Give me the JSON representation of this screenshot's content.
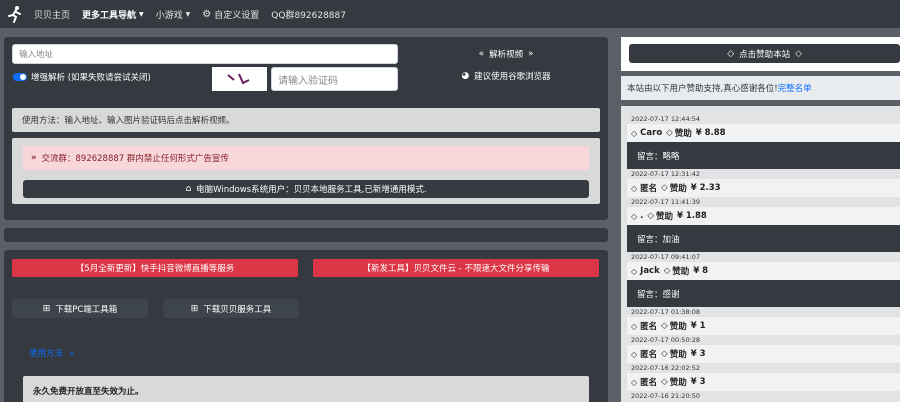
{
  "nav": {
    "home": "贝贝主页",
    "more_tools": "更多工具导航",
    "games": "小游戏",
    "custom_settings": "自定义设置",
    "qq_group": "QQ群892628887"
  },
  "parse": {
    "url_placeholder": "输入地址",
    "parse_button": "解析视频",
    "enhance_label": "增强解析 (如果失败请尝试关闭)",
    "captcha_text": "ヽし",
    "captcha_placeholder": "请输入验证码",
    "browser_button": "建议使用谷歌浏览器",
    "usage_text": "使用方法：输入地址、输入图片验证码后点击解析视频。",
    "group_notice": "交流群：892628887 群内禁止任何形式广告宣传",
    "windows_button": "电脑Windows系统用户：贝贝本地服务工具,已新增通用模式."
  },
  "promo": {
    "left": "【5月全新更新】快手抖音微博直播等服务",
    "right": "【新发工具】贝贝文件云 - 不限速大文件分享传输",
    "download_pc": "下载PC端工具箱",
    "download_service": "下载贝贝服务工具",
    "usage_link": "使用方法",
    "free_text": "永久免费开放直至失效为止。"
  },
  "sidebar": {
    "donate_button": "点击赞助本站",
    "notice": "本站由以下用户赞助支持,真心感谢各位!",
    "notice_link": "完整名单",
    "donations": [
      {
        "date": "2022-07-17 12:44:54",
        "name": "Caro",
        "label": "赞助",
        "amount": "¥ 8.88",
        "message": "留言：略略"
      },
      {
        "date": "2022-07-17 12:31:42",
        "name": "匿名",
        "label": "赞助",
        "amount": "¥ 2.33",
        "message": ""
      },
      {
        "date": "2022-07-17 11:41:39",
        "name": ".",
        "label": "赞助",
        "amount": "¥ 1.88",
        "message": "留言：加油"
      },
      {
        "date": "2022-07-17 09:41:07",
        "name": "Jack",
        "label": "赞助",
        "amount": "¥ 8",
        "message": "留言：感谢"
      },
      {
        "date": "2022-07-17 01:38:08",
        "name": "匿名",
        "label": "赞助",
        "amount": "¥ 1",
        "message": ""
      },
      {
        "date": "2022-07-17 00:50:28",
        "name": "匿名",
        "label": "赞助",
        "amount": "¥ 3",
        "message": ""
      },
      {
        "date": "2022-07-16 22:02:52",
        "name": "匿名",
        "label": "赞助",
        "amount": "¥ 3",
        "message": ""
      },
      {
        "date": "2022-07-16 21:20:50",
        "name": "",
        "label": "",
        "amount": "",
        "message": ""
      }
    ]
  },
  "colors": {
    "navbar": "#343a40",
    "background": "#5b6068",
    "accent_red": "#dc3545",
    "accent_blue": "#0d6efd"
  }
}
